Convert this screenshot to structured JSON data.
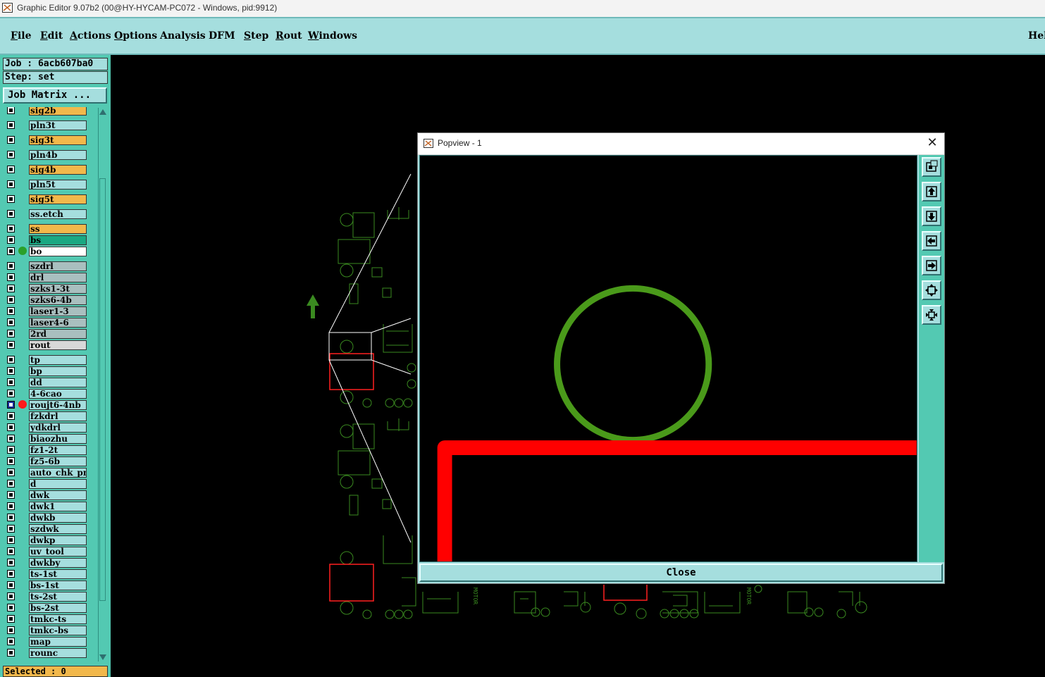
{
  "window": {
    "title": "Graphic Editor 9.07b2 (00@HY-HYCAM-PC072 - Windows, pid:9912)"
  },
  "menu": [
    {
      "label": "File",
      "hot": "F"
    },
    {
      "label": "Edit",
      "hot": "E"
    },
    {
      "label": "Actions",
      "hot": "A"
    },
    {
      "label": "Options",
      "hot": "O"
    },
    {
      "label": "Analysis",
      "hot": ""
    },
    {
      "label": "DFM",
      "hot": ""
    },
    {
      "label": "Step",
      "hot": "S"
    },
    {
      "label": "Rout",
      "hot": "R"
    },
    {
      "label": "Windows",
      "hot": "W"
    }
  ],
  "menu_help": "Hel",
  "panel": {
    "job": "Job : 6acb607ba0",
    "step": "Step: set",
    "job_matrix": "Job Matrix ...",
    "selected": "Selected : 0"
  },
  "colors": {
    "board": "#f2b84b",
    "plane": "#a5dede",
    "active": "#1aa882",
    "work": "#ffffff",
    "drill": "#a9bfbf",
    "rout": "#d8d8d8",
    "teal": "#53c9b2",
    "red": "#ff0000",
    "green": "#4a9a1a"
  },
  "layers": [
    {
      "name": "sig2b",
      "color": "#f2b84b"
    },
    {
      "name": "pln3t",
      "color": "#a5dede"
    },
    {
      "name": "sig3t",
      "color": "#f2b84b"
    },
    {
      "name": "pln4b",
      "color": "#a5dede"
    },
    {
      "name": "sig4b",
      "color": "#f2b84b"
    },
    {
      "name": "pln5t",
      "color": "#a5dede"
    },
    {
      "name": "sig5t",
      "color": "#f2b84b"
    },
    {
      "name": "ss.etch",
      "color": "#a5dede"
    },
    {
      "name": "ss",
      "color": "#f2b84b"
    },
    {
      "name": "bs",
      "color": "#1aa882"
    },
    {
      "name": "bo",
      "color": "#ffffff",
      "dot": "#2aa02a"
    },
    {
      "name": "szdrl",
      "color": "#a9bfbf"
    },
    {
      "name": "drl",
      "color": "#a9bfbf"
    },
    {
      "name": "szks1-3t",
      "color": "#a9bfbf"
    },
    {
      "name": "szks6-4b",
      "color": "#a9bfbf"
    },
    {
      "name": "laser1-3",
      "color": "#a9bfbf"
    },
    {
      "name": "laser4-6",
      "color": "#a9bfbf"
    },
    {
      "name": "2rd",
      "color": "#a9bfbf"
    },
    {
      "name": "rout",
      "color": "#d8d8d8"
    },
    {
      "name": "tp",
      "color": "#a5dede"
    },
    {
      "name": "bp",
      "color": "#a5dede"
    },
    {
      "name": "dd",
      "color": "#a5dede"
    },
    {
      "name": "4-6cao",
      "color": "#a5dede"
    },
    {
      "name": "roujt6-4nb",
      "color": "#a5dede",
      "dot": "#ff1a1a",
      "selected": true
    },
    {
      "name": "fzkdrl",
      "color": "#a5dede"
    },
    {
      "name": "ydkdrl",
      "color": "#a5dede"
    },
    {
      "name": "biaozhu",
      "color": "#a5dede"
    },
    {
      "name": "fz1-2t",
      "color": "#a5dede"
    },
    {
      "name": "fz5-6b",
      "color": "#a5dede"
    },
    {
      "name": "auto_chk_pn",
      "color": "#a5dede"
    },
    {
      "name": "d",
      "color": "#a5dede"
    },
    {
      "name": "dwk",
      "color": "#a5dede"
    },
    {
      "name": "dwk1",
      "color": "#a5dede"
    },
    {
      "name": "dwkb",
      "color": "#a5dede"
    },
    {
      "name": "szdwk",
      "color": "#a5dede"
    },
    {
      "name": "dwkp",
      "color": "#a5dede"
    },
    {
      "name": "uv_tool",
      "color": "#a5dede"
    },
    {
      "name": "dwkby",
      "color": "#a5dede"
    },
    {
      "name": "ts-1st",
      "color": "#a5dede"
    },
    {
      "name": "bs-1st",
      "color": "#a5dede"
    },
    {
      "name": "ts-2st",
      "color": "#a5dede"
    },
    {
      "name": "bs-2st",
      "color": "#a5dede"
    },
    {
      "name": "tmkc-ts",
      "color": "#a5dede"
    },
    {
      "name": "tmkc-bs",
      "color": "#a5dede"
    },
    {
      "name": "map",
      "color": "#a5dede"
    },
    {
      "name": "rounc",
      "color": "#a5dede"
    }
  ],
  "board_labels": {
    "a": "MOTOR",
    "b": "MOTOR"
  },
  "popview": {
    "title": "Popview - 1",
    "close_x": "✕",
    "close_label": "Close",
    "tools": [
      "zoom-window-icon",
      "pan-up-icon",
      "pan-down-icon",
      "pan-left-icon",
      "pan-right-icon",
      "zoom-in-icon",
      "zoom-out-icon"
    ]
  }
}
